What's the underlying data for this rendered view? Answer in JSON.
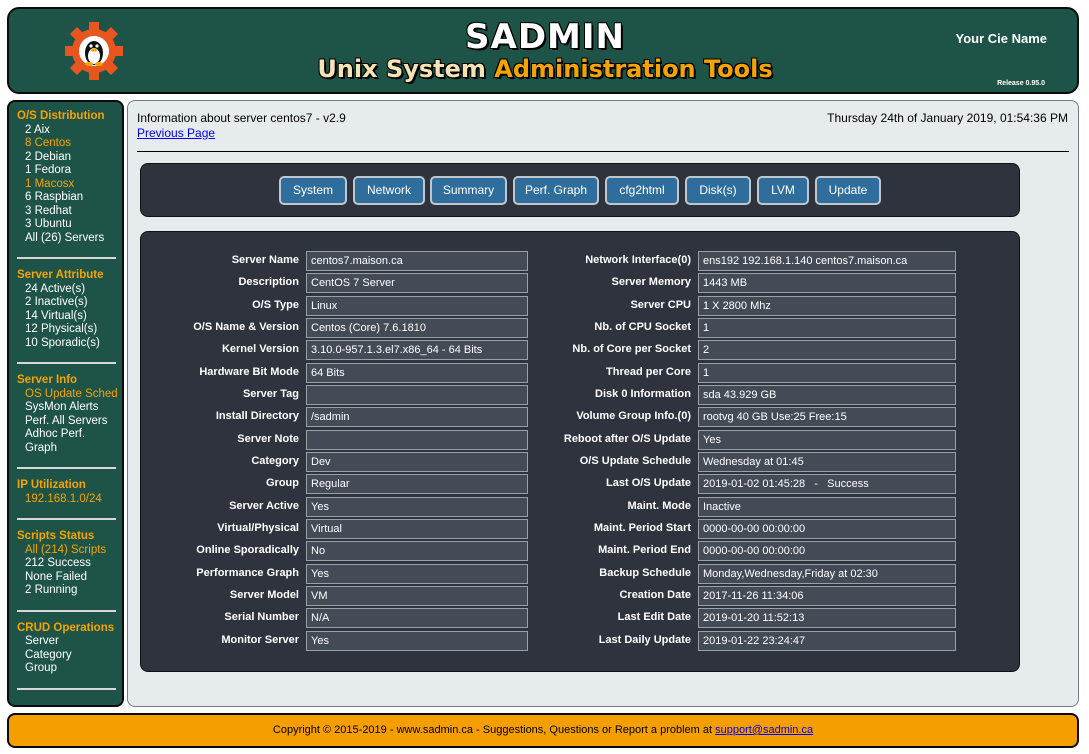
{
  "header": {
    "title": "SADMIN",
    "subtitle_part1": "Unix System ",
    "subtitle_part2": "Administration Tools",
    "company": "Your Cie Name",
    "release": "Release 0.95.0"
  },
  "sidebar": {
    "os_title": "O/S Distribution",
    "os_items": [
      "2 Aix",
      "8 Centos",
      "2 Debian",
      "1 Fedora",
      "1 Macosx",
      "6 Raspbian",
      "3 Redhat",
      "3 Ubuntu",
      "All (26) Servers"
    ],
    "attr_title": "Server Attribute",
    "attr_items": [
      "24 Active(s)",
      "2 Inactive(s)",
      "14 Virtual(s)",
      "12 Physical(s)",
      "10 Sporadic(s)"
    ],
    "info_title": "Server Info",
    "info_items": [
      "OS Update Sched",
      "SysMon Alerts",
      "Perf. All Servers",
      "Adhoc Perf.",
      "Graph"
    ],
    "ip_title": "IP Utilization",
    "ip_items": [
      "192.168.1.0/24"
    ],
    "scripts_title": "Scripts Status",
    "scripts_items": [
      "All (214) Scripts",
      "212 Success",
      "None Failed",
      "2 Running"
    ],
    "crud_title": "CRUD Operations",
    "crud_items": [
      "Server",
      "Category",
      "Group"
    ]
  },
  "main": {
    "info": "Information about server centos7 - v2.9",
    "previous": "Previous Page",
    "date": "Thursday 24th of January 2019, 01:54:36 PM",
    "buttons": [
      "System",
      "Network",
      "Summary",
      "Perf. Graph",
      "cfg2html",
      "Disk(s)",
      "LVM",
      "Update"
    ]
  },
  "details_left": [
    {
      "label": "Server Name",
      "value": "centos7.maison.ca"
    },
    {
      "label": "Description",
      "value": "CentOS 7 Server"
    },
    {
      "label": "O/S Type",
      "value": "Linux"
    },
    {
      "label": "O/S Name & Version",
      "value": "Centos (Core) 7.6.1810"
    },
    {
      "label": "Kernel Version",
      "value": "3.10.0-957.1.3.el7.x86_64 - 64 Bits"
    },
    {
      "label": "Hardware Bit Mode",
      "value": "64 Bits"
    },
    {
      "label": "Server Tag",
      "value": ""
    },
    {
      "label": "Install Directory",
      "value": "/sadmin"
    },
    {
      "label": "Server Note",
      "value": ""
    },
    {
      "label": "Category",
      "value": "Dev"
    },
    {
      "label": "Group",
      "value": "Regular"
    },
    {
      "label": "Server Active",
      "value": "Yes"
    },
    {
      "label": "Virtual/Physical",
      "value": "Virtual"
    },
    {
      "label": "Online Sporadically",
      "value": "No"
    },
    {
      "label": "Performance Graph",
      "value": "Yes"
    },
    {
      "label": "Server Model",
      "value": "VM"
    },
    {
      "label": "Serial Number",
      "value": "N/A"
    },
    {
      "label": "Monitor Server",
      "value": "Yes"
    }
  ],
  "details_right": [
    {
      "label": "Network Interface(0)",
      "value": "ens192 192.168.1.140 centos7.maison.ca"
    },
    {
      "label": "Server Memory",
      "value": "1443 MB"
    },
    {
      "label": "Server CPU",
      "value": "1 X 2800 Mhz"
    },
    {
      "label": "Nb. of CPU Socket",
      "value": "1"
    },
    {
      "label": "Nb. of Core per Socket",
      "value": "2"
    },
    {
      "label": "Thread per Core",
      "value": "1"
    },
    {
      "label": "Disk 0 Information",
      "value": "sda 43.929 GB"
    },
    {
      "label": "Volume Group Info.(0)",
      "value": "rootvg 40 GB Use:25 Free:15"
    },
    {
      "label": "Reboot after O/S Update",
      "value": "Yes"
    },
    {
      "label": "O/S Update Schedule",
      "value": "Wednesday at 01:45"
    },
    {
      "label": "Last O/S Update",
      "value": "2019-01-02 01:45:28   -   Success"
    },
    {
      "label": "Maint. Mode",
      "value": "Inactive"
    },
    {
      "label": "Maint. Period Start",
      "value": "0000-00-00 00:00:00"
    },
    {
      "label": "Maint. Period End",
      "value": "0000-00-00 00:00:00"
    },
    {
      "label": "Backup Schedule",
      "value": "Monday,Wednesday,Friday at 02:30"
    },
    {
      "label": "Creation Date",
      "value": "2017-11-26 11:34:06"
    },
    {
      "label": "Last Edit Date",
      "value": "2019-01-20 11:52:13"
    },
    {
      "label": "Last Daily Update",
      "value": "2019-01-22 23:24:47"
    }
  ],
  "footer": {
    "text": "Copyright © 2015-2019 - www.sadmin.ca - Suggestions, Questions or Report a problem at ",
    "email": "support@sadmin.ca"
  }
}
